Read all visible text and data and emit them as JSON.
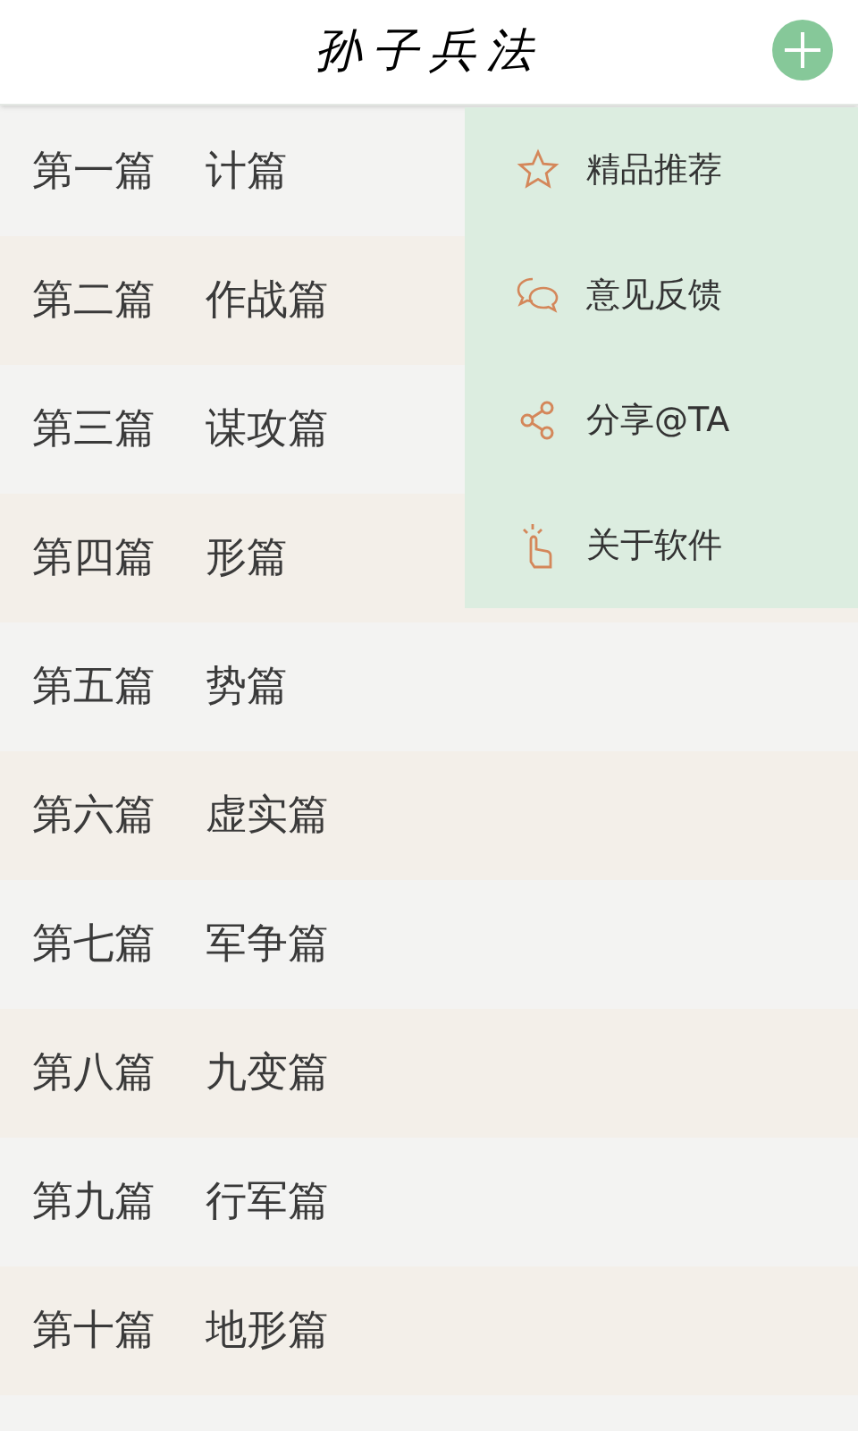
{
  "header": {
    "title": "孙子兵法"
  },
  "chapters": [
    {
      "number": "第一篇",
      "name": "计篇"
    },
    {
      "number": "第二篇",
      "name": "作战篇"
    },
    {
      "number": "第三篇",
      "name": "谋攻篇"
    },
    {
      "number": "第四篇",
      "name": "形篇"
    },
    {
      "number": "第五篇",
      "name": "势篇"
    },
    {
      "number": "第六篇",
      "name": "虚实篇"
    },
    {
      "number": "第七篇",
      "name": "军争篇"
    },
    {
      "number": "第八篇",
      "name": "九变篇"
    },
    {
      "number": "第九篇",
      "name": "行军篇"
    },
    {
      "number": "第十篇",
      "name": "地形篇"
    }
  ],
  "menu": [
    {
      "kind": "star",
      "label": "精品推荐"
    },
    {
      "kind": "chat",
      "label": "意见反馈"
    },
    {
      "kind": "share",
      "label": "分享@TA"
    },
    {
      "kind": "tap",
      "label": "关于软件"
    }
  ]
}
